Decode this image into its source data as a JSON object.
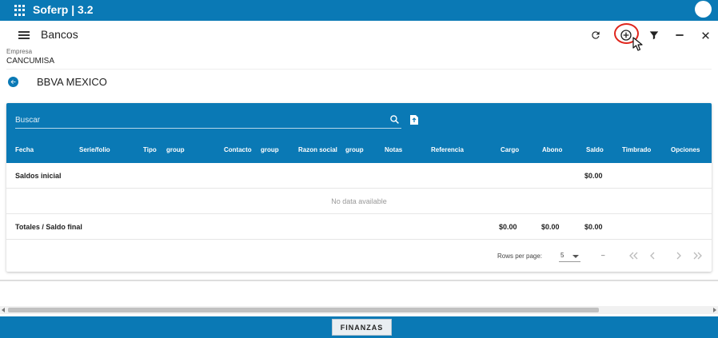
{
  "appbar": {
    "title": "Soferp | 3.2"
  },
  "toolbar": {
    "title": "Bancos"
  },
  "company": {
    "label": "Empresa",
    "value": "CANCUMISA"
  },
  "bank": {
    "title": "BBVA MEXICO"
  },
  "search": {
    "placeholder": "Buscar"
  },
  "table": {
    "columns": [
      "Fecha",
      "Serie/folio",
      "Tipo",
      "group",
      "Contacto",
      "group",
      "Razon social",
      "group",
      "Notas",
      "Referencia",
      "Cargo",
      "Abono",
      "Saldo",
      "Timbrado",
      "Opciones"
    ],
    "saldos_inicial": {
      "label": "Saldos inicial",
      "saldo": "$0.00"
    },
    "no_data": "No data available",
    "totales": {
      "label": "Totales / Saldo final",
      "cargo": "$0.00",
      "abono": "$0.00",
      "saldo": "$0.00"
    }
  },
  "pagination": {
    "rows_per_page_label": "Rows per page:",
    "rows_per_page": "5",
    "range": "–"
  },
  "bottom": {
    "module": "FINANZAS"
  },
  "colors": {
    "primary": "#0a79b5",
    "highlight": "#e0261d"
  }
}
